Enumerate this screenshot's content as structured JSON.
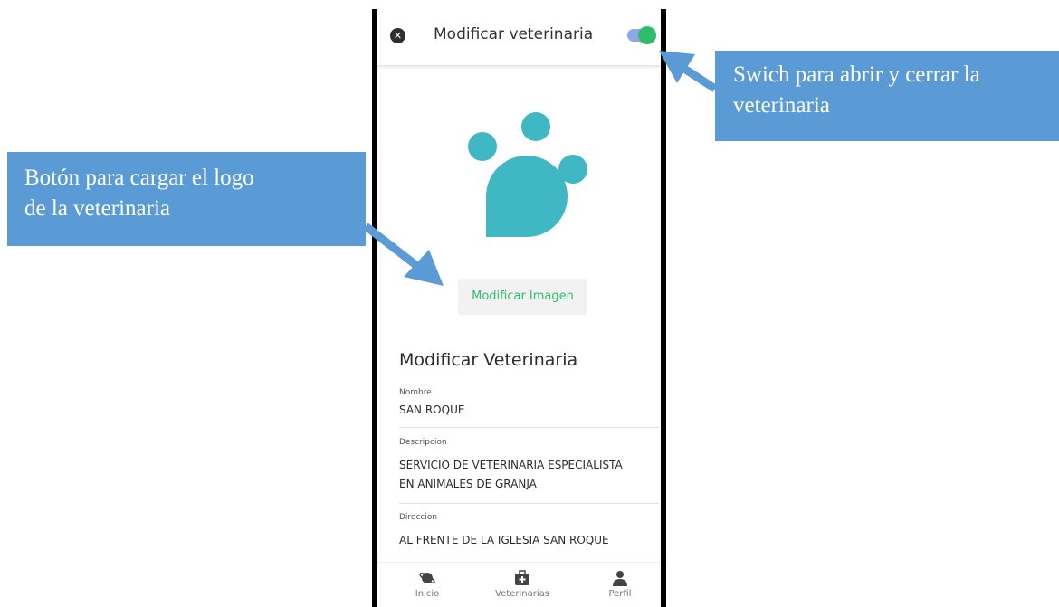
{
  "header": {
    "title": "Modificar veterinaria",
    "close_icon": "close-icon",
    "switch_state": "on"
  },
  "logo": {
    "icon": "paw-icon",
    "color": "#3fb8c4"
  },
  "image_button": {
    "label": "Modificar Imagen"
  },
  "form": {
    "title": "Modificar Veterinaria",
    "fields": [
      {
        "label": "Nombre",
        "value": "SAN ROQUE"
      },
      {
        "label": "Descripcion",
        "value_line1": "SERVICIO DE VETERINARIA ESPECIALISTA",
        "value_line2": "EN ANIMALES DE GRANJA"
      },
      {
        "label": "Direccion",
        "value": "AL FRENTE DE LA IGLESIA SAN ROQUE"
      }
    ]
  },
  "nav": {
    "items": [
      {
        "label": "Inicio",
        "icon": "planet-icon"
      },
      {
        "label": "Veterinarias",
        "icon": "medical-kit-icon"
      },
      {
        "label": "Perfil",
        "icon": "person-icon"
      }
    ]
  },
  "callouts": {
    "left_line1": "Botón para cargar el logo",
    "left_line2": "de la veterinaria",
    "right_line1": "Swich para abrir y cerrar la",
    "right_line2": "veterinaria"
  },
  "colors": {
    "accent_green": "#2dbe6c",
    "callout_blue": "#5b9bd5",
    "toggle_track": "#8fa6e8"
  }
}
